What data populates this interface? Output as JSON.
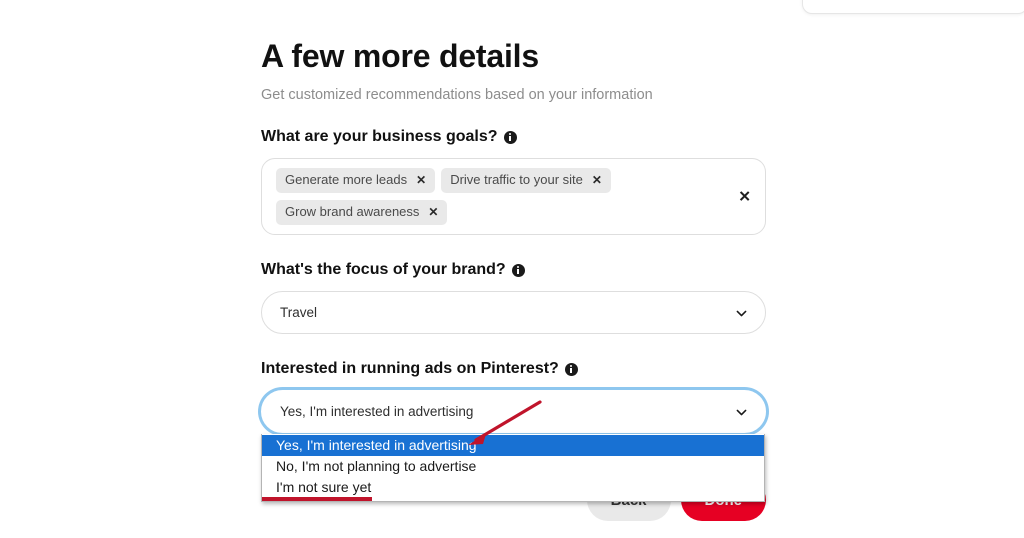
{
  "page": {
    "title": "A few more details",
    "subtitle": "Get customized recommendations based on your information"
  },
  "fields": {
    "business_goals": {
      "label": "What are your business goals?",
      "info_icon": "info-icon",
      "chips": [
        {
          "label": "Generate more leads",
          "remove_icon": "✕"
        },
        {
          "label": "Drive traffic to your site",
          "remove_icon": "✕"
        },
        {
          "label": "Grow brand awareness",
          "remove_icon": "✕"
        }
      ],
      "clear_all_icon": "✕"
    },
    "brand_focus": {
      "label": "What's the focus of your brand?",
      "info_icon": "info-icon",
      "value": "Travel",
      "chevron_icon": "chevron-down-icon"
    },
    "ads_interest": {
      "label": "Interested in running ads on Pinterest?",
      "info_icon": "info-icon",
      "value": "Yes, I'm interested in advertising",
      "chevron_icon": "chevron-down-icon",
      "options": [
        "Yes, I'm interested in advertising",
        "No, I'm not planning to advertise",
        "I'm not sure yet"
      ],
      "selected_index": 0
    }
  },
  "actions": {
    "back_label": "Back",
    "done_label": "Done"
  },
  "colors": {
    "accent_red": "#e60023",
    "highlight_blue": "#1871d3",
    "focus_ring": "#8ec7ef",
    "chip_bg": "#e9e9e9",
    "annotation_red": "#c0142b"
  }
}
